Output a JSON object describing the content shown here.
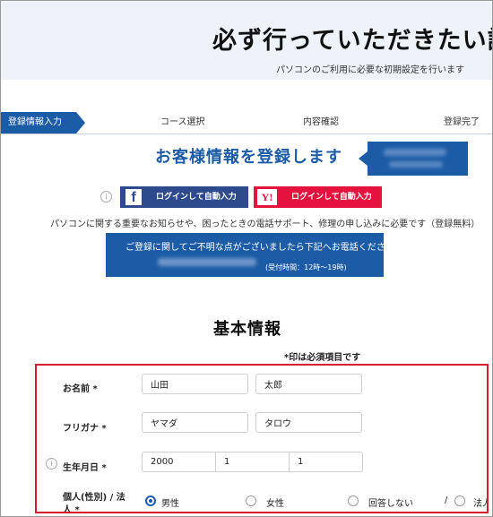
{
  "header": {
    "title": "必ず行っていただきたい設",
    "subtitle": "パソコンのご利用に必要な初期設定を行います"
  },
  "steps": [
    {
      "label": "登録情報入力",
      "active": true
    },
    {
      "label": "コース選択",
      "active": false
    },
    {
      "label": "内容確認",
      "active": false
    },
    {
      "label": "登録完了",
      "active": false
    }
  ],
  "register": {
    "title": "お客様情報を登録します"
  },
  "social": {
    "facebook_label": "ログインして自動入力",
    "yahoo_label": "ログインして自動入力",
    "facebook_logo": "f",
    "yahoo_logo": "Y!"
  },
  "notice": "パソコンに関する重要なお知らせや、困ったときの電話サポート、修理の申し込みに必要です（登録無料）",
  "phone": {
    "message": "ご登録に関してご不明な点がございましたら下記へお電話ください。",
    "hours": "(受付時間：12時〜19時)"
  },
  "basic": {
    "title": "基本情報",
    "required_note": "*印は必須項目です"
  },
  "form": {
    "name": {
      "label": "お名前 *",
      "last": "山田",
      "first": "太郎"
    },
    "kana": {
      "label": "フリガナ *",
      "last": "ヤマダ",
      "first": "タロウ"
    },
    "birth": {
      "label": "生年月日 *",
      "year": "2000",
      "month": "1",
      "day": "1"
    },
    "type": {
      "label_line1": "個人(性別) / 法",
      "label_line2": "人 *",
      "options": [
        "男性",
        "女性",
        "回答しない",
        "法人"
      ],
      "separator": "/",
      "selected": "男性"
    }
  },
  "colors": {
    "accent": "#1c5ca6",
    "facebook": "#2d4b8c",
    "yahoo": "#e5123d",
    "highlight_border": "#d91c2b",
    "header_bg": "#edf3f9"
  },
  "icons": [
    "info-icon",
    "facebook-logo-icon",
    "yahoo-logo-icon",
    "radio-icon"
  ]
}
